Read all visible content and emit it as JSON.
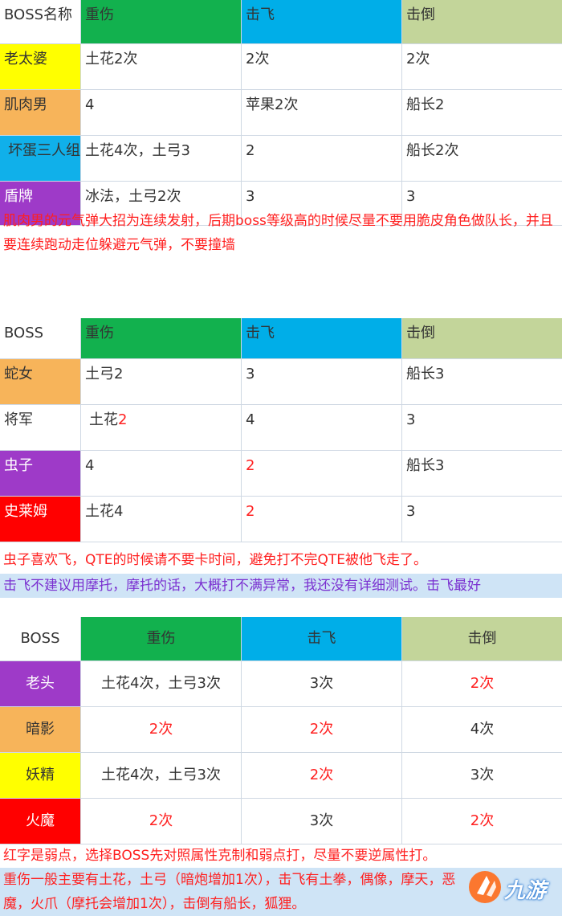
{
  "table1": {
    "headers": [
      "BOSS名称",
      "重伤",
      "击飞",
      "击倒"
    ],
    "rows": [
      {
        "boss": "老太婆",
        "c1": "土花2次",
        "c2": "2次",
        "c3": "2次"
      },
      {
        "boss": "肌肉男",
        "c1": "4",
        "c2": "苹果2次",
        "c3": "船长2"
      },
      {
        "boss": "坏蛋三人组",
        "c1": "土花4次，土弓3",
        "c2": "2",
        "c3": "船长2次"
      },
      {
        "boss": "盾牌",
        "c1": "冰法，土弓2次",
        "c2": "3",
        "c3": "3"
      }
    ],
    "note": "肌肉男的元气弹大招为连续发射，后期boss等级高的时候尽量不要用脆皮角色做队长，并且要连续跑动走位躲避元气弹，不要撞墙"
  },
  "table2": {
    "headers": [
      "BOSS",
      "重伤",
      "击飞",
      "击倒"
    ],
    "rows": [
      {
        "boss": "蛇女",
        "c1": "土弓2",
        "c2": "3",
        "c3": "船长3"
      },
      {
        "boss": "将军",
        "c1a": "土花",
        "c1b": "2",
        "c2": "4",
        "c3": "3"
      },
      {
        "boss": "虫子",
        "c1": "4",
        "c2": "2",
        "c3": "船长3"
      },
      {
        "boss": "史莱姆",
        "c1": "土花4",
        "c2": "2",
        "c3": "3"
      }
    ],
    "note1": "虫子喜欢飞，QTE的时候请不要卡时间，避免打不完QTE被他飞走了。",
    "note2": "击飞不建议用摩托，摩托的话，大概打不满异常，我还没有详细测试。击飞最好"
  },
  "table3": {
    "headers": [
      "BOSS",
      "重伤",
      "击飞",
      "击倒"
    ],
    "rows": [
      {
        "boss": "老头",
        "c1": "土花4次，土弓3次",
        "c2": "3次",
        "c3": "2次"
      },
      {
        "boss": "暗影",
        "c1": "2次",
        "c2": "2次",
        "c3": "4次"
      },
      {
        "boss": "妖精",
        "c1": "土花4次，土弓3次",
        "c2": "2次",
        "c3": "3次"
      },
      {
        "boss": "火魔",
        "c1": "2次",
        "c2": "3次",
        "c3": "2次"
      }
    ],
    "note1": "红字是弱点，选择BOSS先对照属性克制和弱点打，尽量不要逆属性打。",
    "note2": "重伤一般主要有土花，土弓（暗炮增加1次），击飞有土拳，偶像，摩天，恶",
    "note3": "魔，火爪（摩托会增加1次），击倒有船长，狐狸。"
  },
  "watermark": {
    "text": "九游"
  },
  "colors": {
    "green": "#12b14e",
    "blue": "#00aee8",
    "sage": "#c3d59a",
    "yellow": "#ffff00",
    "orange": "#f7b45a",
    "purple": "#9e3ac8",
    "red": "#ff0000",
    "weak_text": "#ff2020"
  }
}
